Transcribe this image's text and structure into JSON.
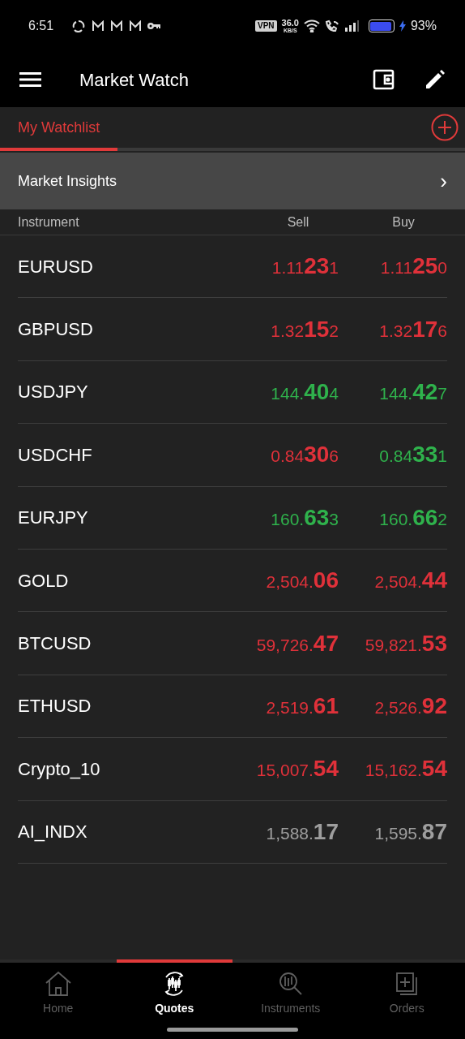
{
  "status_bar": {
    "time": "6:51",
    "vpn": "VPN",
    "speed": "36.0",
    "speed_unit": "KB/S",
    "battery": "93%"
  },
  "header": {
    "title": "Market Watch"
  },
  "tabs": [
    {
      "label": "My Watchlist",
      "selected": true
    }
  ],
  "insights": {
    "label": "Market Insights",
    "chevron": "›"
  },
  "columns": [
    "Instrument",
    "Sell",
    "Buy"
  ],
  "rows": [
    {
      "name": "EURUSD",
      "sell": {
        "pre": "1.11",
        "big": "23",
        "post": "1",
        "color": "#e0313a"
      },
      "buy": {
        "pre": "1.11",
        "big": "25",
        "post": "0",
        "color": "#e0313a"
      }
    },
    {
      "name": "GBPUSD",
      "sell": {
        "pre": "1.32",
        "big": "15",
        "post": "2",
        "color": "#e0313a"
      },
      "buy": {
        "pre": "1.32",
        "big": "17",
        "post": "6",
        "color": "#e0313a"
      }
    },
    {
      "name": "USDJPY",
      "sell": {
        "pre": "144.",
        "big": "40",
        "post": "4",
        "color": "#2fb24c"
      },
      "buy": {
        "pre": "144.",
        "big": "42",
        "post": "7",
        "color": "#2fb24c"
      }
    },
    {
      "name": "USDCHF",
      "sell": {
        "pre": "0.84",
        "big": "30",
        "post": "6",
        "color": "#e0313a"
      },
      "buy": {
        "pre": "0.84",
        "big": "33",
        "post": "1",
        "color": "#2fb24c"
      }
    },
    {
      "name": "EURJPY",
      "sell": {
        "pre": "160.",
        "big": "63",
        "post": "3",
        "color": "#2fb24c"
      },
      "buy": {
        "pre": "160.",
        "big": "66",
        "post": "2",
        "color": "#2fb24c"
      }
    },
    {
      "name": "GOLD",
      "sell": {
        "pre": "2,504.",
        "big": "06",
        "color": "#e0313a"
      },
      "buy": {
        "pre": "2,504.",
        "big": "44",
        "color": "#e0313a"
      }
    },
    {
      "name": "BTCUSD",
      "sell": {
        "pre": "59,726.",
        "big": "47",
        "color": "#e0313a"
      },
      "buy": {
        "pre": "59,821.",
        "big": "53",
        "color": "#e0313a"
      }
    },
    {
      "name": "ETHUSD",
      "sell": {
        "pre": "2,519.",
        "big": "61",
        "color": "#e0313a"
      },
      "buy": {
        "pre": "2,526.",
        "big": "92",
        "color": "#e0313a"
      }
    },
    {
      "name": "Crypto_10",
      "sell": {
        "pre": "15,007.",
        "big": "54",
        "color": "#e0313a"
      },
      "buy": {
        "pre": "15,162.",
        "big": "54",
        "color": "#e0313a"
      }
    },
    {
      "name": "AI_INDX",
      "sell": {
        "pre": "1,588.",
        "big": "17",
        "color": "#9e9e9e"
      },
      "buy": {
        "pre": "1,595.",
        "big": "87",
        "color": "#9e9e9e"
      }
    }
  ],
  "nav": [
    {
      "label": "Home",
      "kind": "home",
      "selected": false
    },
    {
      "label": "Quotes",
      "kind": "quotes",
      "selected": true
    },
    {
      "label": "Instruments",
      "kind": "instruments",
      "selected": false
    },
    {
      "label": "Orders",
      "kind": "orders",
      "selected": false
    }
  ]
}
